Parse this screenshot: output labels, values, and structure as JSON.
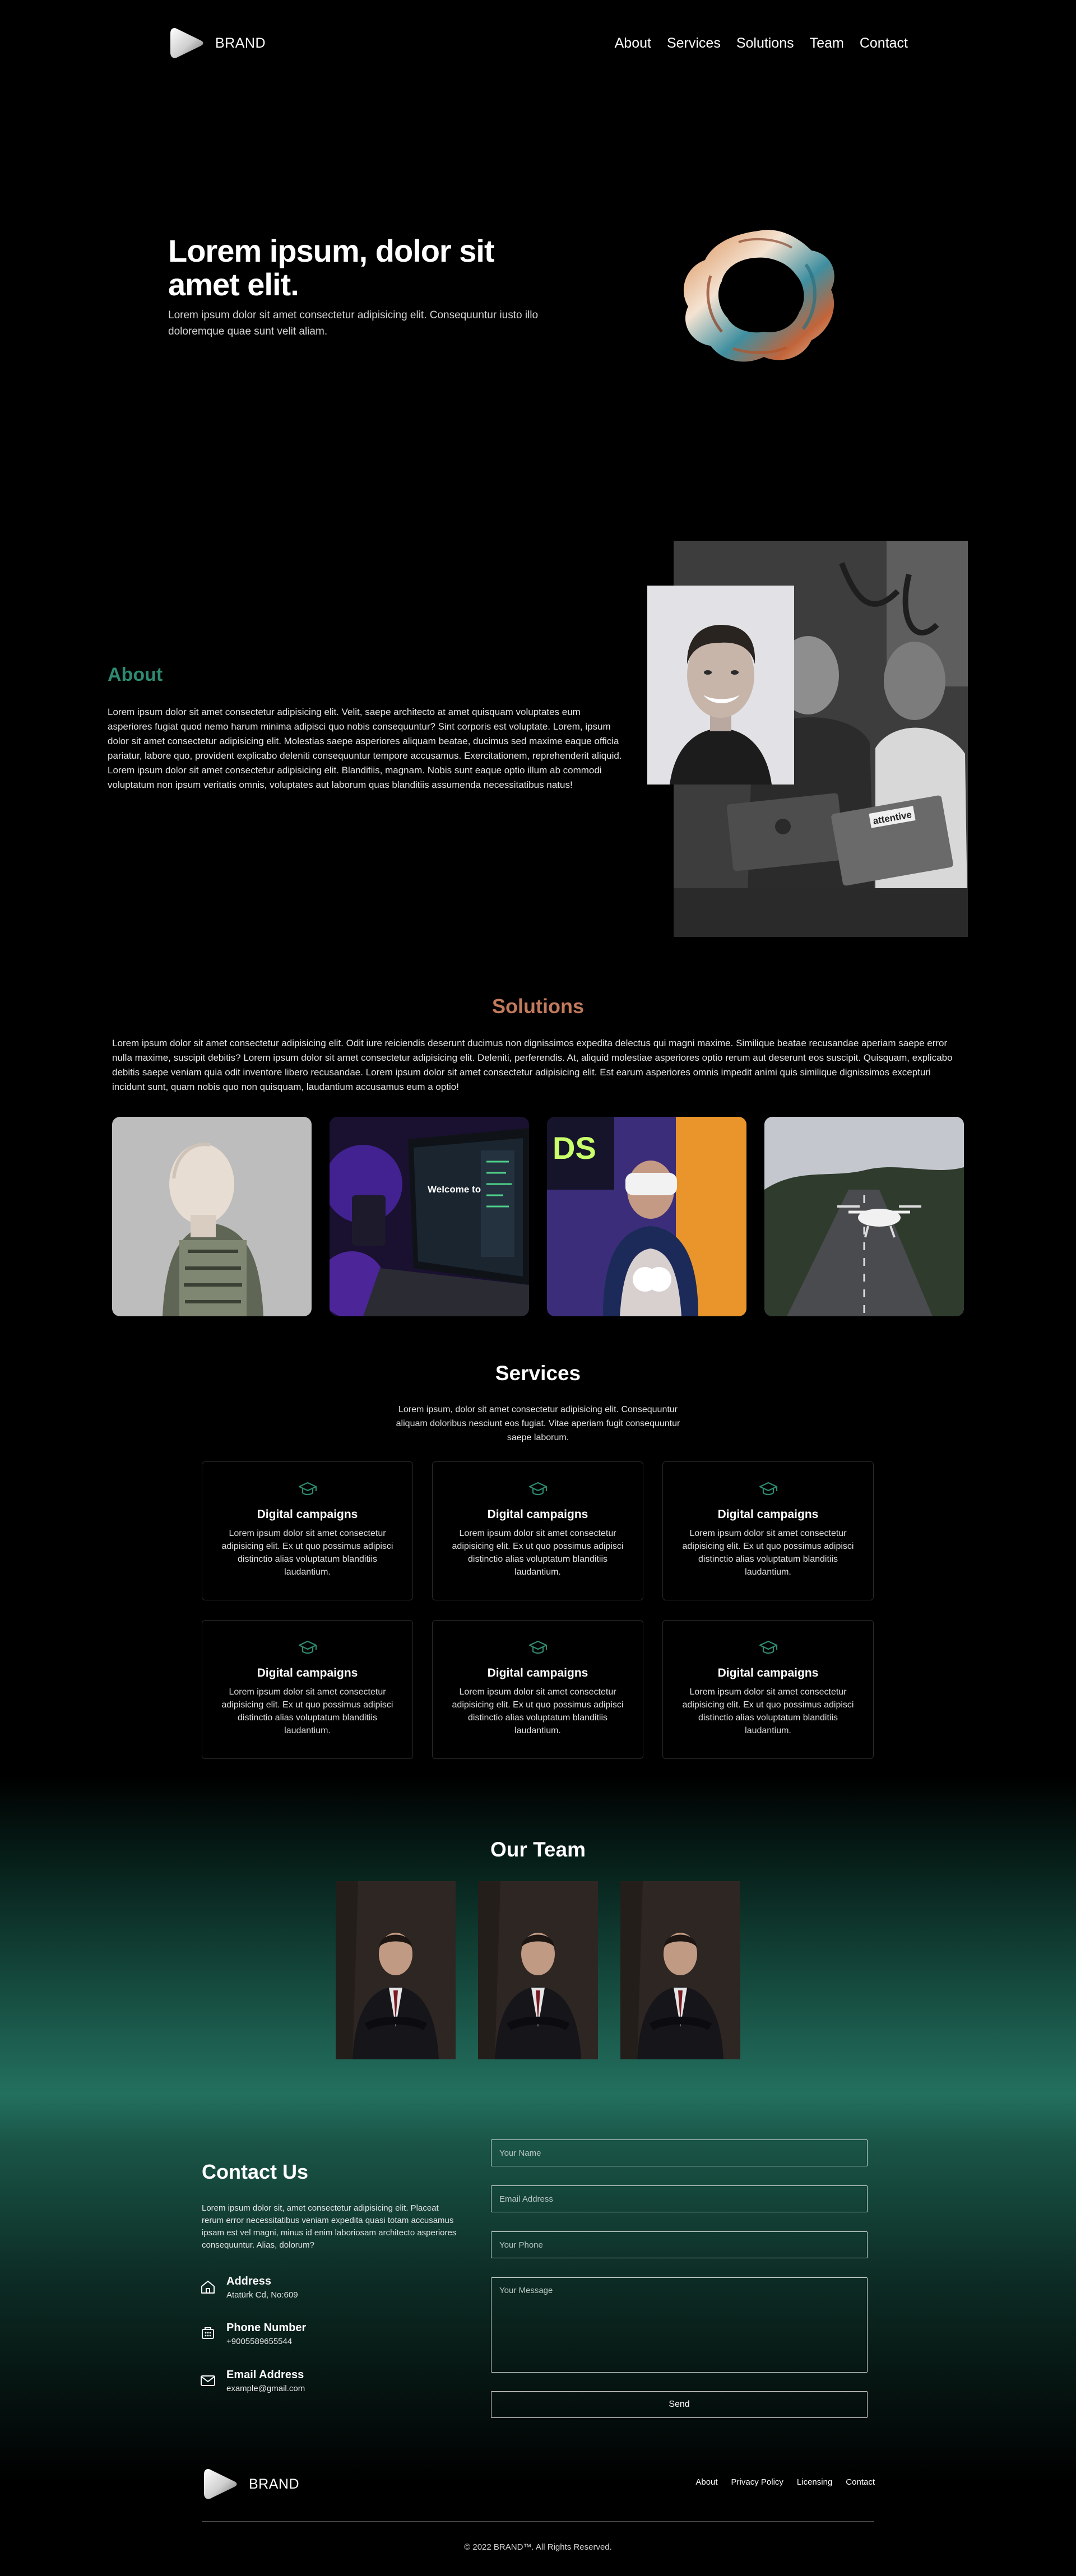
{
  "nav": {
    "brand": "BRAND",
    "links": [
      "About",
      "Services",
      "Solutions",
      "Team",
      "Contact"
    ]
  },
  "hero": {
    "title": "Lorem ipsum, dolor sit amet elit.",
    "text": "Lorem ipsum dolor sit amet consectetur adipisicing elit. Consequuntur iusto illo doloremque quae sunt velit aliam."
  },
  "about": {
    "title": "About",
    "text": "Lorem ipsum dolor sit amet consectetur adipisicing elit. Velit, saepe architecto at amet quisquam voluptates eum asperiores fugiat quod nemo harum minima adipisci quo nobis consequuntur? Sint corporis est voluptate. Lorem, ipsum dolor sit amet consectetur adipisicing elit. Molestias saepe asperiores aliquam beatae, ducimus sed maxime eaque officia pariatur, labore quo, provident explicabo deleniti consequuntur tempore accusamus. Exercitationem, reprehenderit aliquid. Lorem ipsum dolor sit amet consectetur adipisicing elit. Blanditiis, magnam. Nobis sunt eaque optio illum ab commodi voluptatum non ipsum veritatis omnis, voluptates aut laborum quas blanditiis assumenda necessitatibus natus!",
    "laptop_sticker": "attentive"
  },
  "solutions": {
    "title": "Solutions",
    "text": "Lorem ipsum dolor sit amet consectetur adipisicing elit. Odit iure reiciendis deserunt ducimus non dignissimos expedita delectus qui magni maxime. Similique beatae recusandae aperiam saepe error nulla maxime, suscipit debitis? Lorem ipsum dolor sit amet consectetur adipisicing elit. Deleniti, perferendis. At, aliquid molestiae asperiores optio rerum aut deserunt eos suscipit. Quisquam, explicabo debitis saepe veniam quia odit inventore libero recusandae. Lorem ipsum dolor sit amet consectetur adipisicing elit. Est earum asperiores omnis impedit animi quis similique dignissimos excepturi incidunt sunt, quam nobis quo non quisquam, laudantium accusamus eum a optio!",
    "screen_text": "Welcome to Pyth",
    "ds_text": "DS"
  },
  "services": {
    "title": "Services",
    "text": "Lorem ipsum, dolor sit amet consectetur adipisicing elit. Consequuntur aliquam doloribus nesciunt eos fugiat. Vitae aperiam fugit consequuntur saepe laborum.",
    "cards": [
      {
        "title": "Digital campaigns",
        "text": "Lorem ipsum dolor sit amet consectetur adipisicing elit. Ex ut quo possimus adipisci distinctio alias voluptatum blanditiis laudantium."
      },
      {
        "title": "Digital campaigns",
        "text": "Lorem ipsum dolor sit amet consectetur adipisicing elit. Ex ut quo possimus adipisci distinctio alias voluptatum blanditiis laudantium."
      },
      {
        "title": "Digital campaigns",
        "text": "Lorem ipsum dolor sit amet consectetur adipisicing elit. Ex ut quo possimus adipisci distinctio alias voluptatum blanditiis laudantium."
      },
      {
        "title": "Digital campaigns",
        "text": "Lorem ipsum dolor sit amet consectetur adipisicing elit. Ex ut quo possimus adipisci distinctio alias voluptatum blanditiis laudantium."
      },
      {
        "title": "Digital campaigns",
        "text": "Lorem ipsum dolor sit amet consectetur adipisicing elit. Ex ut quo possimus adipisci distinctio alias voluptatum blanditiis laudantium."
      },
      {
        "title": "Digital campaigns",
        "text": "Lorem ipsum dolor sit amet consectetur adipisicing elit. Ex ut quo possimus adipisci distinctio alias voluptatum blanditiis laudantium."
      }
    ]
  },
  "team": {
    "title": "Our Team"
  },
  "contact": {
    "title": "Contact Us",
    "text": "Lorem ipsum dolor sit, amet consectetur adipisicing elit. Placeat rerum error necessitatibus veniam expedita quasi totam accusamus ipsam est vel magni, minus id enim laboriosam architecto asperiores consequuntur. Alias, dolorum?",
    "address_label": "Address",
    "address_value": "Atatürk Cd, No:609",
    "phone_label": "Phone Number",
    "phone_value": "+9005589655544",
    "email_label": "Email Address",
    "email_value": "example@gmail.com",
    "form": {
      "name_placeholder": "Your Name",
      "email_placeholder": "Email Address",
      "phone_placeholder": "Your Phone",
      "message_placeholder": "Your Message",
      "send_label": "Send"
    }
  },
  "footer": {
    "brand": "BRAND",
    "links": [
      "About",
      "Privacy Policy",
      "Licensing",
      "Contact"
    ],
    "copyright": "© 2022 BRAND™. All Rights Reserved."
  },
  "colors": {
    "accent_green": "#2e8a70",
    "accent_orange": "#c27a5c",
    "background": "#000000"
  }
}
